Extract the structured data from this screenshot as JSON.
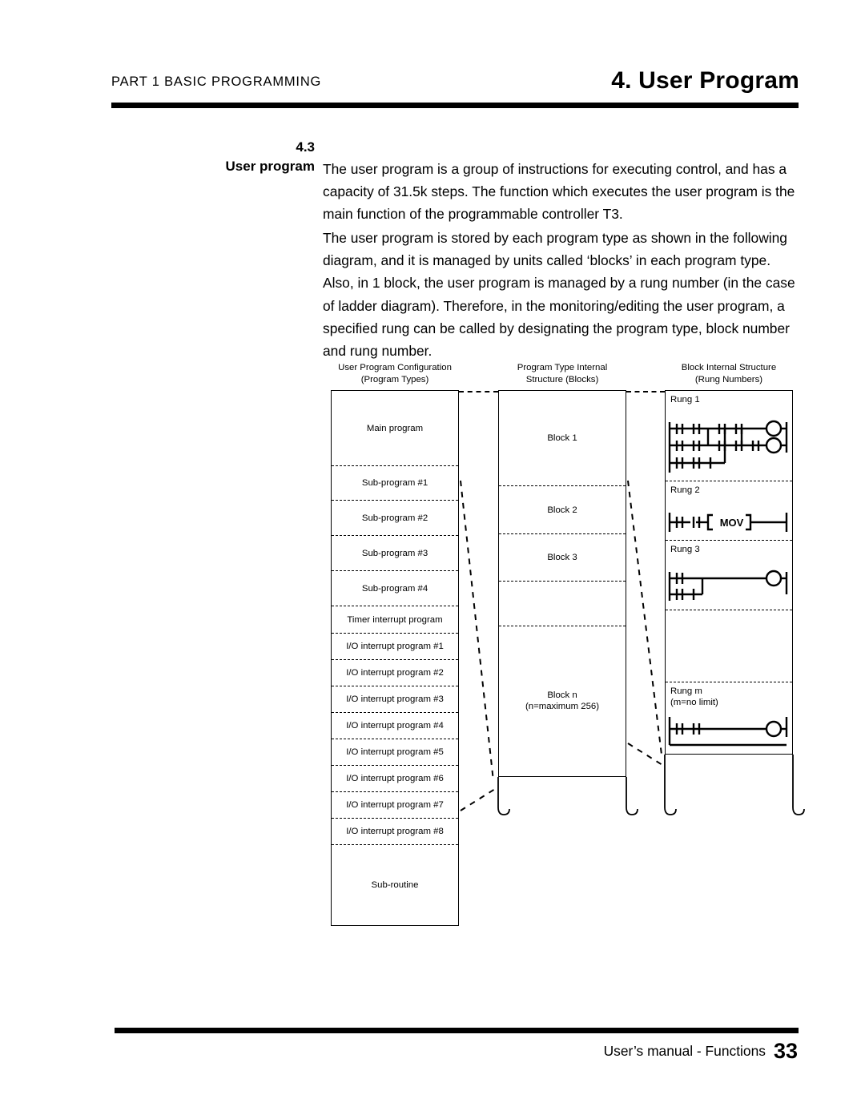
{
  "header": {
    "left_text": "PART 1  BASIC  PROGRAMMING",
    "right_text": "4. User Program"
  },
  "section": {
    "number": "4.3",
    "title": "User program"
  },
  "paragraphs": {
    "p1": "The user program is a group of instructions for executing control, and has a capacity of 31.5k steps.  The function which executes the user program is the main function of the programmable controller T3.",
    "p2": "The user program is stored by each program type as shown in the following diagram, and it is managed by units called ‘blocks’ in each program type.  Also, in 1 block, the user program is managed by a rung number (in the case of ladder diagram).  Therefore, in the monitoring/editing the user program, a specified rung can be called by designating the program type, block number and rung number."
  },
  "diagram": {
    "columns": {
      "left": {
        "header_line1": "User Program Configuration",
        "header_line2": "(Program Types)",
        "items": [
          "Main program",
          "Sub-program #1",
          "Sub-program #2",
          "Sub-program #3",
          "Sub-program #4",
          "Timer interrupt program",
          "I/O interrupt program #1",
          "I/O interrupt program #2",
          "I/O interrupt program #3",
          "I/O interrupt program #4",
          "I/O interrupt program #5",
          "I/O interrupt program #6",
          "I/O interrupt program #7",
          "I/O interrupt program #8",
          "Sub-routine"
        ]
      },
      "middle": {
        "header_line1": "Program Type Internal",
        "header_line2": "Structure (Blocks)",
        "items": [
          {
            "label": "Block 1",
            "sub": ""
          },
          {
            "label": "Block 2",
            "sub": ""
          },
          {
            "label": "Block 3",
            "sub": ""
          },
          {
            "label": "",
            "sub": ""
          },
          {
            "label": "Block n",
            "sub": "(n=maximum 256)"
          }
        ]
      },
      "right": {
        "header_line1": "Block Internal Structure",
        "header_line2": "(Rung Numbers)",
        "rungs": [
          {
            "label": "Rung 1",
            "sub": ""
          },
          {
            "label": "Rung 2",
            "sub": "",
            "instruction": "MOV"
          },
          {
            "label": "Rung 3",
            "sub": ""
          },
          {
            "label": "",
            "sub": ""
          },
          {
            "label": "Rung m",
            "sub": "(m=no limit)"
          }
        ]
      }
    }
  },
  "footer": {
    "text": "User’s manual - Functions",
    "page": "33"
  }
}
